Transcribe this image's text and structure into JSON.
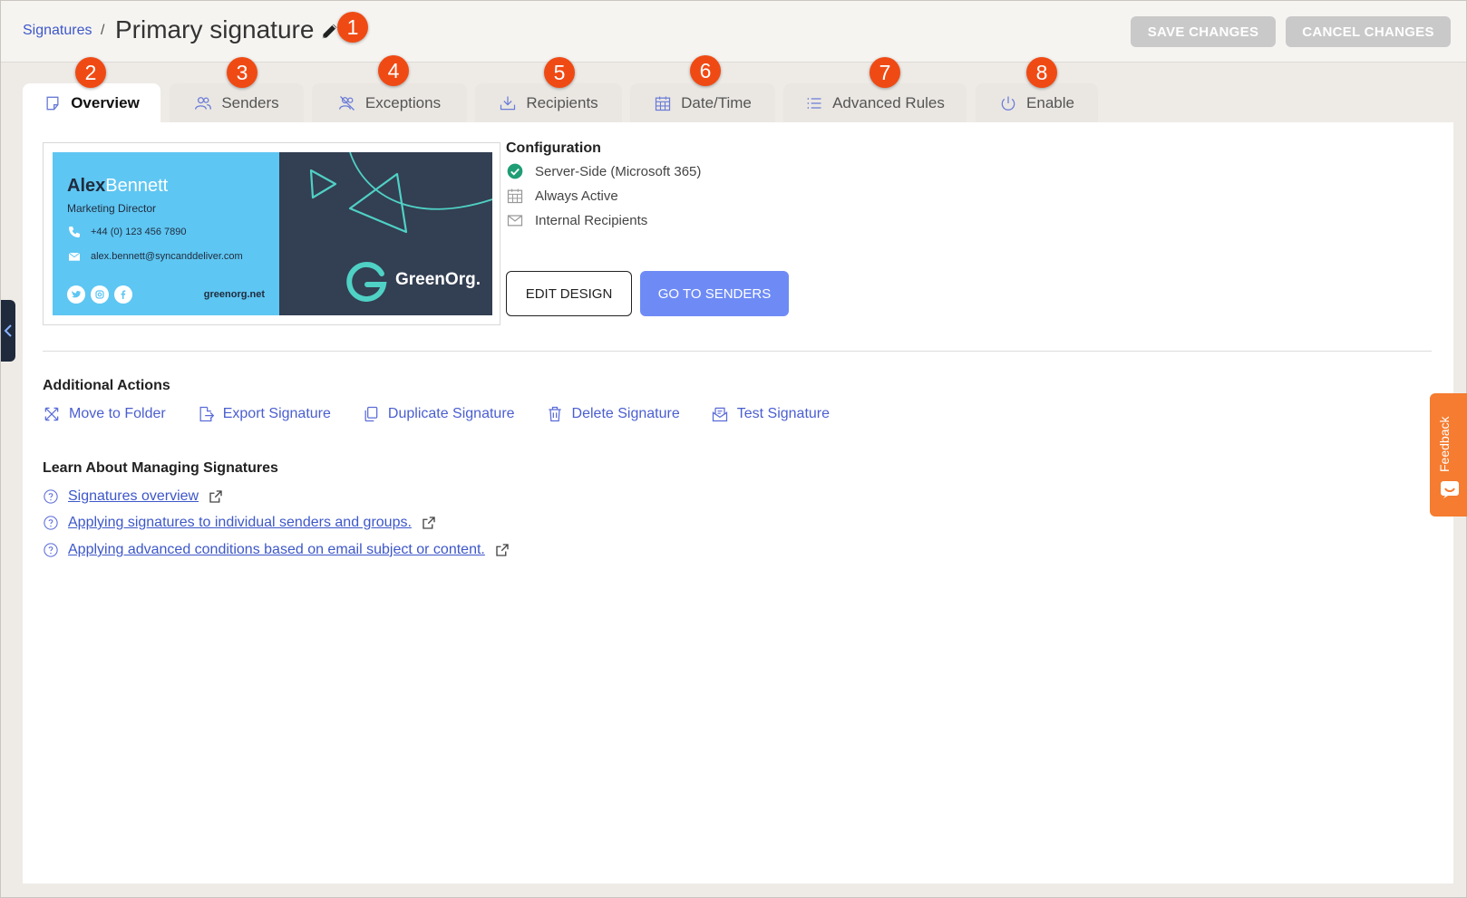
{
  "header": {
    "breadcrumb": "Signatures",
    "separator": "/",
    "title": "Primary signature",
    "save_label": "SAVE CHANGES",
    "cancel_label": "CANCEL CHANGES"
  },
  "callouts": [
    "1",
    "2",
    "3",
    "4",
    "5",
    "6",
    "7",
    "8"
  ],
  "tabs": [
    {
      "label": "Overview",
      "icon": "note-icon",
      "active": true
    },
    {
      "label": "Senders",
      "icon": "users-icon"
    },
    {
      "label": "Exceptions",
      "icon": "users-exclude-icon"
    },
    {
      "label": "Recipients",
      "icon": "inbox-download-icon"
    },
    {
      "label": "Date/Time",
      "icon": "calendar-icon"
    },
    {
      "label": "Advanced Rules",
      "icon": "list-icon"
    },
    {
      "label": "Enable",
      "icon": "power-icon"
    }
  ],
  "signature_preview": {
    "first_name": "Alex",
    "last_name": "Bennett",
    "role": "Marketing Director",
    "phone": "+44 (0) 123 456 7890",
    "email": "alex.bennett@syncanddeliver.com",
    "website": "greenorg.net",
    "brand": "GreenOrg.",
    "colors": {
      "panel_left": "#5ec6f2",
      "panel_right": "#333f52",
      "accent": "#4fd1c5"
    }
  },
  "configuration": {
    "title": "Configuration",
    "items": [
      {
        "label": "Server-Side (Microsoft 365)",
        "icon": "check-circle-icon"
      },
      {
        "label": "Always Active",
        "icon": "calendar-icon"
      },
      {
        "label": "Internal Recipients",
        "icon": "mail-icon"
      }
    ],
    "edit_label": "EDIT DESIGN",
    "go_label": "GO TO SENDERS"
  },
  "additional_actions": {
    "title": "Additional Actions",
    "items": [
      {
        "label": "Move to Folder",
        "icon": "move-icon"
      },
      {
        "label": "Export Signature",
        "icon": "export-icon"
      },
      {
        "label": "Duplicate Signature",
        "icon": "duplicate-icon"
      },
      {
        "label": "Delete Signature",
        "icon": "trash-icon"
      },
      {
        "label": "Test Signature",
        "icon": "test-mail-icon"
      }
    ]
  },
  "learn": {
    "title": "Learn About Managing Signatures",
    "links": [
      "Signatures overview",
      "Applying signatures to individual senders and groups.",
      "Applying advanced conditions based on email subject or content."
    ]
  },
  "feedback": {
    "label": "Feedback"
  },
  "colors": {
    "link": "#3d57c9",
    "badge": "#f04a14",
    "primary": "#6e8bf5",
    "feedback": "#f57c30"
  }
}
